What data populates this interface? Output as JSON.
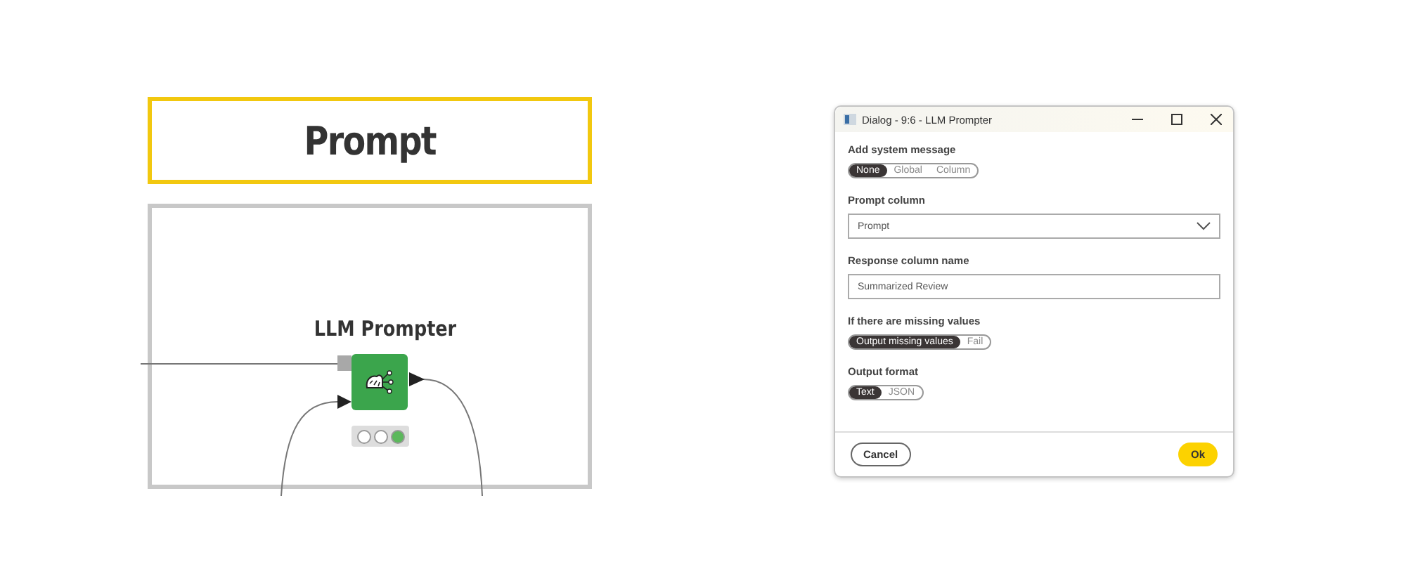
{
  "heading": "Prompt",
  "node": {
    "title": "LLM Prompter",
    "lights": [
      {
        "on": false
      },
      {
        "on": false
      },
      {
        "on": true
      }
    ]
  },
  "dialog": {
    "title": "Dialog - 9:6 - LLM Prompter",
    "sections": [
      {
        "kind": "toggle",
        "label": "Add system message",
        "options": [
          {
            "label": "None",
            "selected": true
          },
          {
            "label": "Global",
            "selected": false
          },
          {
            "label": "Column",
            "selected": false
          }
        ]
      },
      {
        "kind": "select",
        "label": "Prompt column",
        "value": "Prompt"
      },
      {
        "kind": "text",
        "label": "Response column name",
        "value": "Summarized Review"
      },
      {
        "kind": "toggle",
        "label": "If there are missing values",
        "options": [
          {
            "label": "Output missing values",
            "selected": true
          },
          {
            "label": "Fail",
            "selected": false
          }
        ]
      },
      {
        "kind": "toggle",
        "label": "Output format",
        "options": [
          {
            "label": "Text",
            "selected": true
          },
          {
            "label": "JSON",
            "selected": false
          }
        ]
      }
    ],
    "buttons": [
      {
        "label": "Cancel",
        "kind": "secondary"
      },
      {
        "label": "Ok",
        "kind": "primary"
      }
    ]
  }
}
